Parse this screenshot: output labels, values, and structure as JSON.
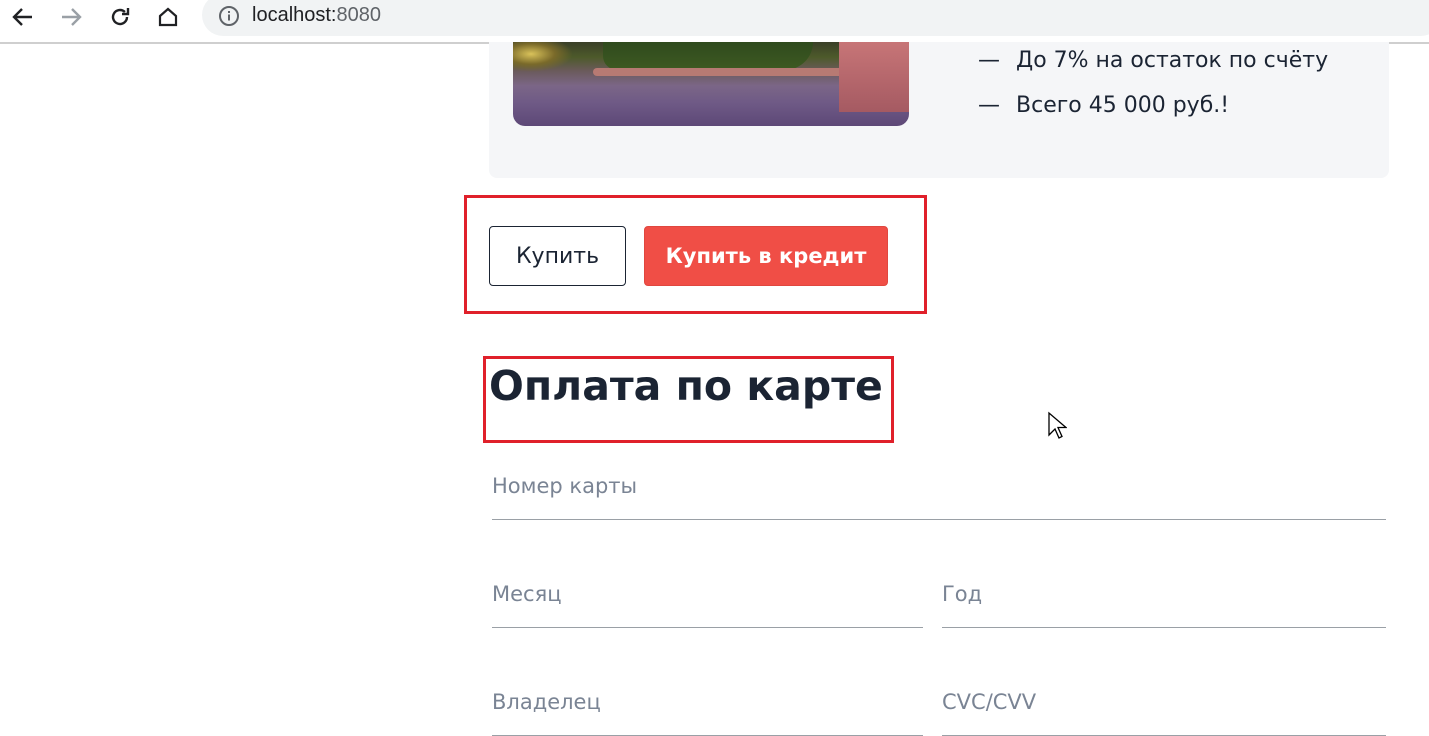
{
  "browser": {
    "url_host": "localhost:",
    "url_port": "8080"
  },
  "product": {
    "features": [
      "До 7% на остаток по счёту",
      "Всего 45 000 руб.!"
    ],
    "feature_marker": "—"
  },
  "actions": {
    "buy_label": "Купить",
    "credit_label": "Купить в кредит"
  },
  "form": {
    "title": "Оплата по карте",
    "card_number_placeholder": "Номер карты",
    "month_placeholder": "Месяц",
    "year_placeholder": "Год",
    "owner_placeholder": "Владелец",
    "cvc_placeholder": "CVC/CVV"
  },
  "colors": {
    "accent": "#f04e46",
    "highlight": "#e0202a",
    "text": "#1b2433"
  }
}
